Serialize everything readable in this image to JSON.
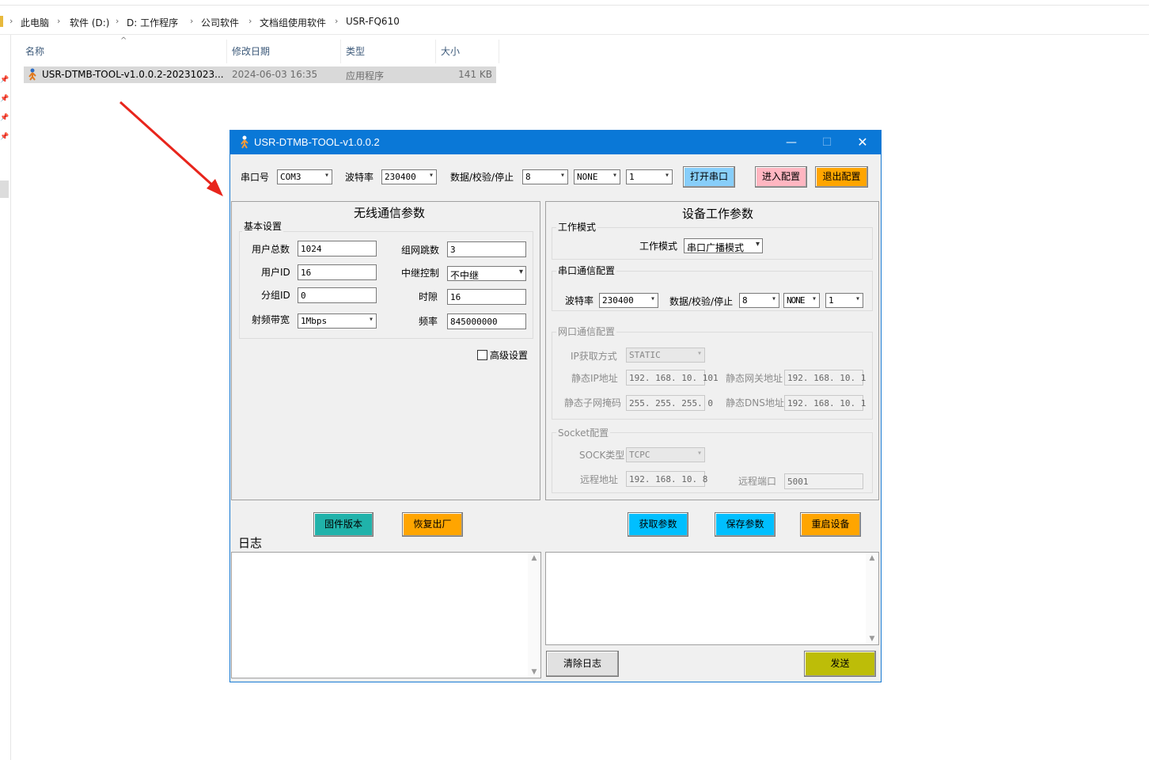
{
  "explorer": {
    "breadcrumbs": [
      "此电脑",
      "软件 (D:)",
      "D: 工作程序",
      "公司软件",
      "文档组使用软件",
      "USR-FQ610"
    ],
    "columns": [
      "名称",
      "修改日期",
      "类型",
      "大小"
    ],
    "file": {
      "name": "USR-DTMB-TOOL-v1.0.0.2-20231023...",
      "date": "2024-06-03 16:35",
      "type": "应用程序",
      "size": "141 KB"
    }
  },
  "window": {
    "title": "USR-DTMB-TOOL-v1.0.0.2",
    "title_icons": [
      "minimize-icon",
      "maximize-icon",
      "close-icon"
    ]
  },
  "toolbar": {
    "port_label": "串口号",
    "port_value": "COM3",
    "baud_label": "波特率",
    "baud_value": "230400",
    "dps_label": "数据/校验/停止",
    "data_bits": "8",
    "parity": "NONE",
    "stop_bits": "1",
    "open_port": "打开串口",
    "enter_config": "进入配置",
    "exit_config": "退出配置"
  },
  "wireless": {
    "title": "无线通信参数",
    "basic_group": "基本设置",
    "total_users_label": "用户总数",
    "total_users": "1024",
    "hops_label": "组网跳数",
    "hops": "3",
    "user_id_label": "用户ID",
    "user_id": "16",
    "relay_label": "中继控制",
    "relay": "不中继",
    "group_id_label": "分组ID",
    "group_id": "0",
    "slot_label": "时隙",
    "slot": "16",
    "bandwidth_label": "射频带宽",
    "bandwidth": "1Mbps",
    "freq_label": "频率",
    "freq": "845000000",
    "advanced_label": "高级设置"
  },
  "device": {
    "title": "设备工作参数",
    "work_group": "工作模式",
    "work_mode_label": "工作模式",
    "work_mode": "串口广播模式",
    "serial_group": "串口通信配置",
    "baud_label": "波特率",
    "baud": "230400",
    "dps_label": "数据/校验/停止",
    "data_bits": "8",
    "parity": "NONE",
    "stop_bits": "1",
    "net_group": "网口通信配置",
    "ip_mode_label": "IP获取方式",
    "ip_mode": "STATIC",
    "static_ip_label": "静态IP地址",
    "static_ip": "192. 168. 10. 101",
    "gateway_label": "静态网关地址",
    "gateway": "192. 168. 10. 1",
    "mask_label": "静态子网掩码",
    "mask": "255. 255. 255. 0",
    "dns_label": "静态DNS地址",
    "dns": "192. 168. 10. 1",
    "socket_group": "Socket配置",
    "sock_type_label": "SOCK类型",
    "sock_type": "TCPC",
    "remote_addr_label": "远程地址",
    "remote_addr": "192. 168. 10. 8",
    "remote_port_label": "远程端口",
    "remote_port": "5001"
  },
  "actions": {
    "firmware": "固件版本",
    "factory": "恢复出厂",
    "get_params": "获取参数",
    "save_params": "保存参数",
    "restart": "重启设备",
    "log_label": "日志",
    "clear_log": "清除日志",
    "send": "发送"
  },
  "colors": {
    "titlebar": "#0a78d7",
    "open_port_btn": "#87cefa",
    "enter_config_btn": "#ffb6c1",
    "exit_config_btn": "#ffa500",
    "firmware_btn": "#20b2aa",
    "factory_btn": "#ffa500",
    "get_params_btn": "#00bfff",
    "save_params_btn": "#00bfff",
    "restart_btn": "#ffa500",
    "send_btn": "#bdbd08",
    "clear_log_btn": "#e1e1e1",
    "arrow": "#e8251c"
  }
}
